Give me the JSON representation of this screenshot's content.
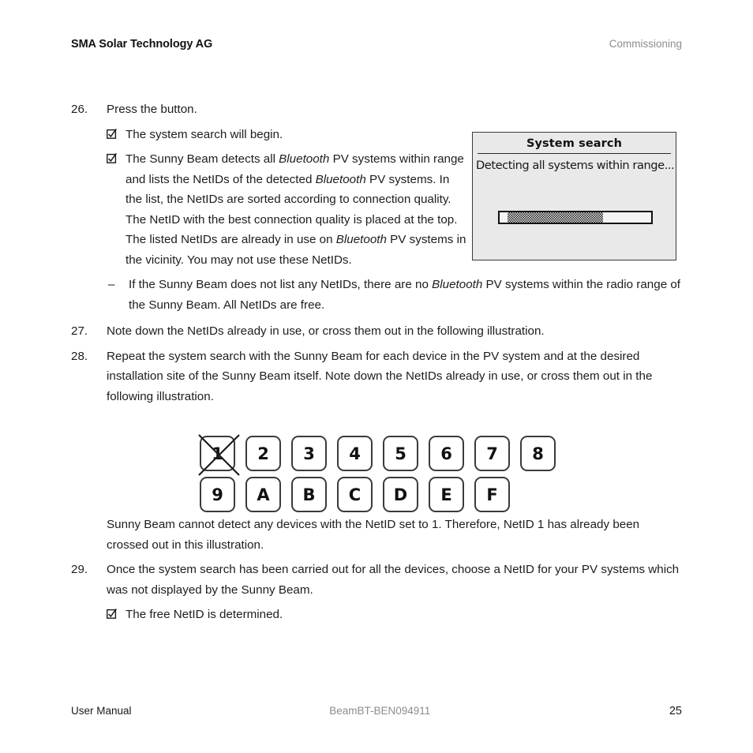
{
  "header": {
    "company": "SMA Solar Technology AG",
    "chapter": "Commissioning"
  },
  "steps": {
    "s26": {
      "number": "26.",
      "text": "Press the button.",
      "results": [
        {
          "icon": "checked-box-icon",
          "text": "The system search will begin."
        }
      ],
      "result_rich_prefix": "The Sunny Beam detects all ",
      "result_rich_italic1": "Bluetooth",
      "result_rich_mid": " PV systems within range and lists the NetIDs of the detected ",
      "result_rich_italic2": "Bluetooth",
      "result_rich_mid2": " PV systems. In the list, the NetIDs are sorted according to connection quality. The NetID with the best connection quality is placed at the top. The listed NetIDs are already in use on ",
      "result_rich_italic3": "Bluetooth",
      "result_rich_suffix": " PV systems in the vicinity. You may not use these NetIDs."
    },
    "dash": {
      "mark": "–",
      "prefix": "If the Sunny Beam does not list any NetIDs, there are no ",
      "italic": "Bluetooth",
      "suffix": " PV systems within the radio range of the Sunny Beam. All NetIDs are free."
    },
    "s27": {
      "number": "27.",
      "text": "Note down the NetIDs already in use, or cross them out in the following illustration."
    },
    "s28": {
      "number": "28.",
      "text": "Repeat the system search with the Sunny Beam for each device in the PV system and at the desired installation site of the Sunny Beam itself. Note down the NetIDs already in use, or cross them out in the following illustration."
    },
    "note_after_grid": "Sunny Beam cannot detect any devices with the NetID set to 1. Therefore, NetID 1 has already been crossed out in this illustration.",
    "s29": {
      "number": "29.",
      "text": "Once the system search has been carried out for all the devices, choose a NetID for your PV systems which was not displayed by the Sunny Beam.",
      "results": [
        {
          "icon": "checked-box-icon",
          "text": "The free NetID is determined."
        }
      ]
    }
  },
  "device_screen": {
    "title": "System search",
    "status": "Detecting all systems within range...",
    "progress_percent": 63,
    "background_color": "#e9e9e9",
    "border_color": "#3a3a3a"
  },
  "netid_grid": {
    "row1": [
      "1",
      "2",
      "3",
      "4",
      "5",
      "6",
      "7",
      "8"
    ],
    "row2": [
      "9",
      "A",
      "B",
      "C",
      "D",
      "E",
      "F"
    ],
    "crossed_out": [
      "1"
    ]
  },
  "footer": {
    "left": "User Manual",
    "center": "BeamBT-BEN094911",
    "page": "25"
  }
}
